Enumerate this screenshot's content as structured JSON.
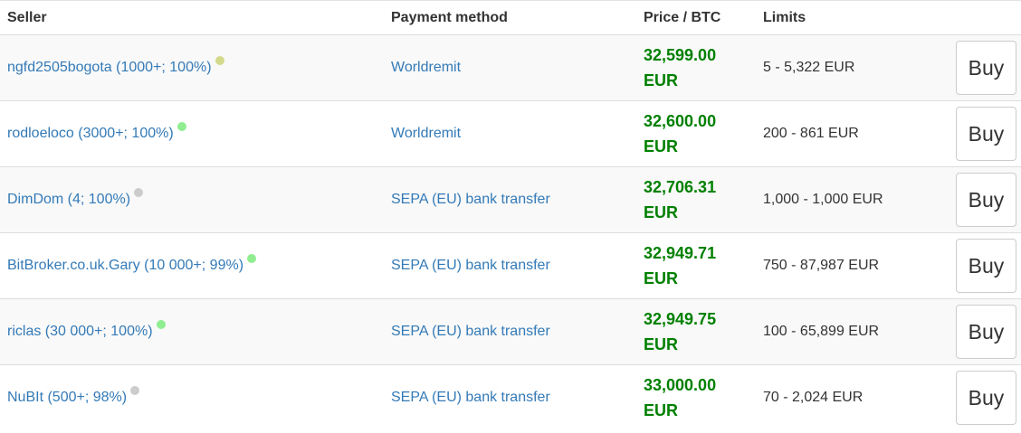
{
  "header": {
    "seller": "Seller",
    "payment_method": "Payment method",
    "price": "Price / BTC",
    "limits": "Limits"
  },
  "buy_label": "Buy",
  "status_colors": {
    "yellow": "#d3d98a",
    "green": "#90ee90",
    "gray": "#cccccc"
  },
  "rows": [
    {
      "seller": "ngfd2505bogota (1000+; 100%)",
      "status": "yellow",
      "payment": "Worldremit",
      "price": "32,599.00",
      "currency": "EUR",
      "limits": "5 - 5,322 EUR"
    },
    {
      "seller": "rodloeloco (3000+; 100%)",
      "status": "green",
      "payment": "Worldremit",
      "price": "32,600.00",
      "currency": "EUR",
      "limits": "200 - 861 EUR"
    },
    {
      "seller": "DimDom (4; 100%)",
      "status": "gray",
      "payment": "SEPA (EU) bank transfer",
      "price": "32,706.31",
      "currency": "EUR",
      "limits": "1,000 - 1,000 EUR"
    },
    {
      "seller": "BitBroker.co.uk.Gary (10 000+; 99%)",
      "status": "green",
      "payment": "SEPA (EU) bank transfer",
      "price": "32,949.71",
      "currency": "EUR",
      "limits": "750 - 87,987 EUR"
    },
    {
      "seller": "riclas (30 000+; 100%)",
      "status": "green",
      "payment": "SEPA (EU) bank transfer",
      "price": "32,949.75",
      "currency": "EUR",
      "limits": "100 - 65,899 EUR"
    },
    {
      "seller": "NuBIt (500+; 98%)",
      "status": "gray",
      "payment": "SEPA (EU) bank transfer",
      "price": "33,000.00",
      "currency": "EUR",
      "limits": "70 - 2,024 EUR"
    }
  ]
}
